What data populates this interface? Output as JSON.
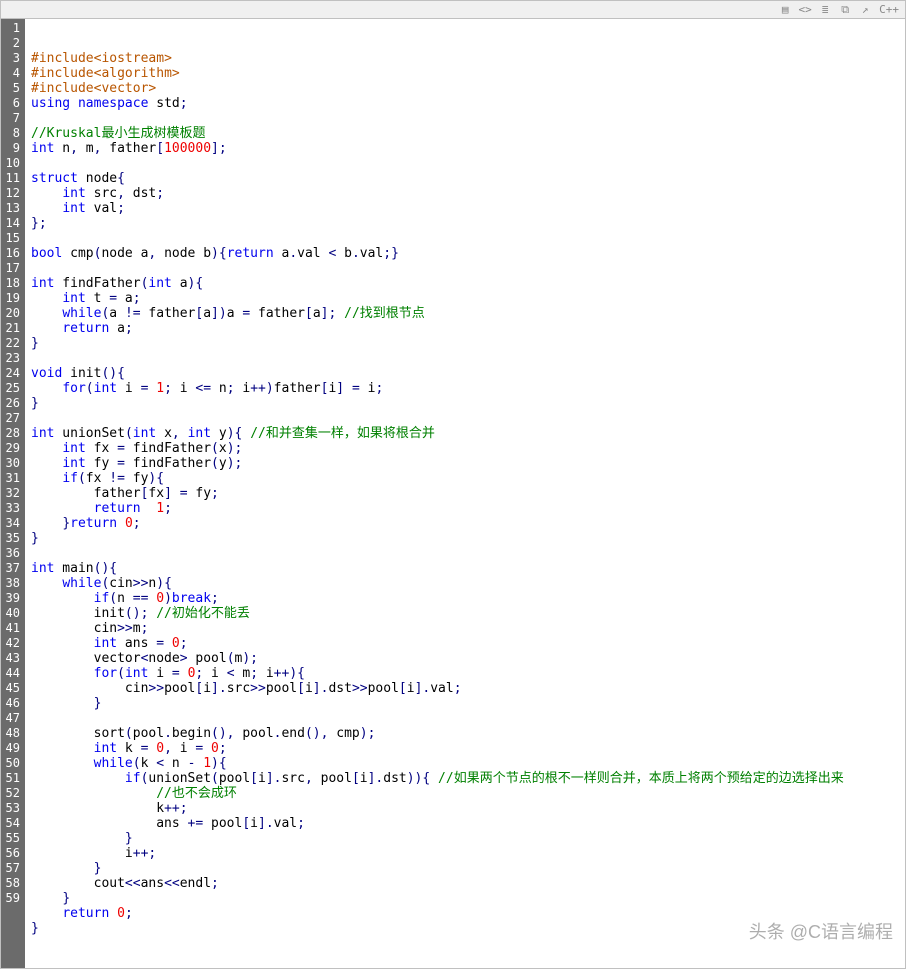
{
  "toolbar": {
    "language": "C++"
  },
  "watermark": "头条 @C语言编程",
  "lines": [
    {
      "n": 1,
      "html": "<span class='pre'>#include</span><span class='pre'>&lt;iostream&gt;</span>"
    },
    {
      "n": 2,
      "html": "<span class='pre'>#include</span><span class='pre'>&lt;algorithm&gt;</span>"
    },
    {
      "n": 3,
      "html": "<span class='pre'>#include</span><span class='pre'>&lt;vector&gt;</span>"
    },
    {
      "n": 4,
      "html": "<span class='kw'>using</span> <span class='kw'>namespace</span> std<span class='op'>;</span>"
    },
    {
      "n": 5,
      "html": ""
    },
    {
      "n": 6,
      "html": "<span class='com'>//Kruskal最小生成树模板题</span>"
    },
    {
      "n": 7,
      "html": "<span class='kw'>int</span> n<span class='op'>,</span> m<span class='op'>,</span> father<span class='op'>[</span><span class='num'>100000</span><span class='op'>];</span>"
    },
    {
      "n": 8,
      "html": ""
    },
    {
      "n": 9,
      "html": "<span class='kw'>struct</span> node<span class='op'>{</span>"
    },
    {
      "n": 10,
      "html": "    <span class='kw'>int</span> src<span class='op'>,</span> dst<span class='op'>;</span>"
    },
    {
      "n": 11,
      "html": "    <span class='kw'>int</span> val<span class='op'>;</span>"
    },
    {
      "n": 12,
      "html": "<span class='op'>};</span>"
    },
    {
      "n": 13,
      "html": ""
    },
    {
      "n": 14,
      "html": "<span class='kw'>bool</span> cmp<span class='op'>(</span>node a<span class='op'>,</span> node b<span class='op'>){</span><span class='kw'>return</span> a<span class='op'>.</span>val <span class='op'>&lt;</span> b<span class='op'>.</span>val<span class='op'>;}</span>"
    },
    {
      "n": 15,
      "html": ""
    },
    {
      "n": 16,
      "html": "<span class='kw'>int</span> findFather<span class='op'>(</span><span class='kw'>int</span> a<span class='op'>){</span>"
    },
    {
      "n": 17,
      "html": "    <span class='kw'>int</span> t <span class='op'>=</span> a<span class='op'>;</span>"
    },
    {
      "n": 18,
      "html": "    <span class='kw'>while</span><span class='op'>(</span>a <span class='op'>!=</span> father<span class='op'>[</span>a<span class='op'>])</span>a <span class='op'>=</span> father<span class='op'>[</span>a<span class='op'>];</span> <span class='com'>//找到根节点</span>"
    },
    {
      "n": 19,
      "html": "    <span class='kw'>return</span> a<span class='op'>;</span>"
    },
    {
      "n": 20,
      "html": "<span class='op'>}</span>"
    },
    {
      "n": 21,
      "html": ""
    },
    {
      "n": 22,
      "html": "<span class='kw'>void</span> init<span class='op'>(){</span>"
    },
    {
      "n": 23,
      "html": "    <span class='kw'>for</span><span class='op'>(</span><span class='kw'>int</span> i <span class='op'>=</span> <span class='num'>1</span><span class='op'>;</span> i <span class='op'>&lt;=</span> n<span class='op'>;</span> i<span class='op'>++)</span>father<span class='op'>[</span>i<span class='op'>]</span> <span class='op'>=</span> i<span class='op'>;</span>"
    },
    {
      "n": 24,
      "html": "<span class='op'>}</span>"
    },
    {
      "n": 25,
      "html": ""
    },
    {
      "n": 26,
      "html": "<span class='kw'>int</span> unionSet<span class='op'>(</span><span class='kw'>int</span> x<span class='op'>,</span> <span class='kw'>int</span> y<span class='op'>){</span> <span class='com'>//和并查集一样，如果将根合并</span>"
    },
    {
      "n": 27,
      "html": "    <span class='kw'>int</span> fx <span class='op'>=</span> findFather<span class='op'>(</span>x<span class='op'>);</span>"
    },
    {
      "n": 28,
      "html": "    <span class='kw'>int</span> fy <span class='op'>=</span> findFather<span class='op'>(</span>y<span class='op'>);</span>"
    },
    {
      "n": 29,
      "html": "    <span class='kw'>if</span><span class='op'>(</span>fx <span class='op'>!=</span> fy<span class='op'>){</span>"
    },
    {
      "n": 30,
      "html": "        father<span class='op'>[</span>fx<span class='op'>]</span> <span class='op'>=</span> fy<span class='op'>;</span>"
    },
    {
      "n": 31,
      "html": "        <span class='kw'>return</span>  <span class='num'>1</span><span class='op'>;</span>"
    },
    {
      "n": 32,
      "html": "    <span class='op'>}</span><span class='kw'>return</span> <span class='num'>0</span><span class='op'>;</span>"
    },
    {
      "n": 33,
      "html": "<span class='op'>}</span>"
    },
    {
      "n": 34,
      "html": ""
    },
    {
      "n": 35,
      "html": "<span class='kw'>int</span> main<span class='op'>(){</span>"
    },
    {
      "n": 36,
      "html": "    <span class='kw'>while</span><span class='op'>(</span>cin<span class='op'>&gt;&gt;</span>n<span class='op'>){</span>"
    },
    {
      "n": 37,
      "html": "        <span class='kw'>if</span><span class='op'>(</span>n <span class='op'>==</span> <span class='num'>0</span><span class='op'>)</span><span class='kw'>break</span><span class='op'>;</span>"
    },
    {
      "n": 38,
      "html": "        init<span class='op'>();</span> <span class='com'>//初始化不能丢</span>"
    },
    {
      "n": 39,
      "html": "        cin<span class='op'>&gt;&gt;</span>m<span class='op'>;</span>"
    },
    {
      "n": 40,
      "html": "        <span class='kw'>int</span> ans <span class='op'>=</span> <span class='num'>0</span><span class='op'>;</span>"
    },
    {
      "n": 41,
      "html": "        vector<span class='op'>&lt;</span>node<span class='op'>&gt;</span> pool<span class='op'>(</span>m<span class='op'>);</span>"
    },
    {
      "n": 42,
      "html": "        <span class='kw'>for</span><span class='op'>(</span><span class='kw'>int</span> i <span class='op'>=</span> <span class='num'>0</span><span class='op'>;</span> i <span class='op'>&lt;</span> m<span class='op'>;</span> i<span class='op'>++){</span>"
    },
    {
      "n": 43,
      "html": "            cin<span class='op'>&gt;&gt;</span>pool<span class='op'>[</span>i<span class='op'>].</span>src<span class='op'>&gt;&gt;</span>pool<span class='op'>[</span>i<span class='op'>].</span>dst<span class='op'>&gt;&gt;</span>pool<span class='op'>[</span>i<span class='op'>].</span>val<span class='op'>;</span>"
    },
    {
      "n": 44,
      "html": "        <span class='op'>}</span>"
    },
    {
      "n": 45,
      "html": ""
    },
    {
      "n": 46,
      "html": "        sort<span class='op'>(</span>pool<span class='op'>.</span>begin<span class='op'>(),</span> pool<span class='op'>.</span>end<span class='op'>(),</span> cmp<span class='op'>);</span>"
    },
    {
      "n": 47,
      "html": "        <span class='kw'>int</span> k <span class='op'>=</span> <span class='num'>0</span><span class='op'>,</span> i <span class='op'>=</span> <span class='num'>0</span><span class='op'>;</span>"
    },
    {
      "n": 48,
      "html": "        <span class='kw'>while</span><span class='op'>(</span>k <span class='op'>&lt;</span> n <span class='op'>-</span> <span class='num'>1</span><span class='op'>){</span>"
    },
    {
      "n": 49,
      "html": "            <span class='kw'>if</span><span class='op'>(</span>unionSet<span class='op'>(</span>pool<span class='op'>[</span>i<span class='op'>].</span>src<span class='op'>,</span> pool<span class='op'>[</span>i<span class='op'>].</span>dst<span class='op'>)){</span> <span class='com'>//如果两个节点的根不一样则合并，本质上将两个预给定的边选择出来</span>"
    },
    {
      "n": 50,
      "html": "                <span class='com'>//也不会成环</span>"
    },
    {
      "n": 51,
      "html": "                k<span class='op'>++;</span>"
    },
    {
      "n": 52,
      "html": "                ans <span class='op'>+=</span> pool<span class='op'>[</span>i<span class='op'>].</span>val<span class='op'>;</span>"
    },
    {
      "n": 53,
      "html": "            <span class='op'>}</span>"
    },
    {
      "n": 54,
      "html": "            i<span class='op'>++;</span>"
    },
    {
      "n": 55,
      "html": "        <span class='op'>}</span>"
    },
    {
      "n": 56,
      "html": "        cout<span class='op'>&lt;&lt;</span>ans<span class='op'>&lt;&lt;</span>endl<span class='op'>;</span>"
    },
    {
      "n": 57,
      "html": "    <span class='op'>}</span>"
    },
    {
      "n": 58,
      "html": "    <span class='kw'>return</span> <span class='num'>0</span><span class='op'>;</span>"
    },
    {
      "n": 59,
      "html": "<span class='op'>}</span>"
    }
  ]
}
